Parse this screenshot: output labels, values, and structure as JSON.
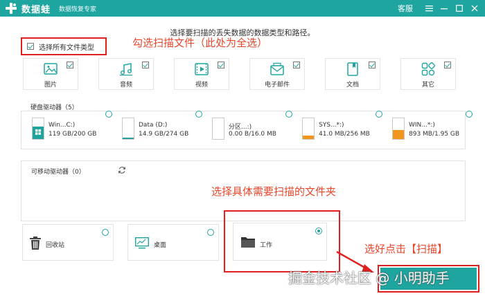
{
  "titlebar": {
    "brand": "数据蛙",
    "tagline": "数据恢复专家",
    "service_label": "客服"
  },
  "prompt": "选择要扫描的丢失数据的数据类型和路径。",
  "select_all": {
    "label": "选择所有文件类型",
    "checked": true
  },
  "annotations": {
    "check_files": "勾选扫描文件（此处为全选）",
    "choose_folder": "选择具体需要扫描的文件夹",
    "click_scan": "选好点击【扫描】"
  },
  "file_types": [
    {
      "label": "图片",
      "icon": "image-icon",
      "checked": true
    },
    {
      "label": "音频",
      "icon": "music-icon",
      "checked": true
    },
    {
      "label": "视频",
      "icon": "video-icon",
      "checked": true
    },
    {
      "label": "电子邮件",
      "icon": "email-icon",
      "checked": true
    },
    {
      "label": "文档",
      "icon": "document-icon",
      "checked": true
    },
    {
      "label": "其它",
      "icon": "other-icon",
      "checked": true
    }
  ],
  "hard_drives": {
    "title": "硬盘驱动器（5）",
    "items": [
      {
        "name": "Win...C:)",
        "size": "119 GB/200 GB",
        "used": 0.595,
        "color": "#1ea5a0"
      },
      {
        "name": "Data (D:)",
        "size": "14.9 GB/274 GB",
        "used": 0.054,
        "color": "#1ea5a0"
      },
      {
        "name": "分区...:)",
        "size": "0.00  B/16.0 MB",
        "used": 0.0,
        "color": "#f0961e"
      },
      {
        "name": "SYS...*:)",
        "size": "41.0 MB/256 MB",
        "used": 0.16,
        "color": "#f0961e"
      },
      {
        "name": "WIN...*:)",
        "size": "893 MB/1.95 GB",
        "used": 0.447,
        "color": "#f0961e"
      }
    ]
  },
  "removable_drives": {
    "title": "可移动驱动器（0）"
  },
  "folders": [
    {
      "label": "回收站",
      "icon": "recycle-bin-icon",
      "selected": false
    },
    {
      "label": "桌面",
      "icon": "desktop-icon",
      "selected": false
    },
    {
      "label": "工作",
      "icon": "folder-icon",
      "selected": true
    }
  ],
  "watermark": "掘金技术社区 @ 小明助手",
  "colors": {
    "accent": "#1ea5a0",
    "annotation": "#e8462a",
    "highlight_box": "#e02020"
  }
}
